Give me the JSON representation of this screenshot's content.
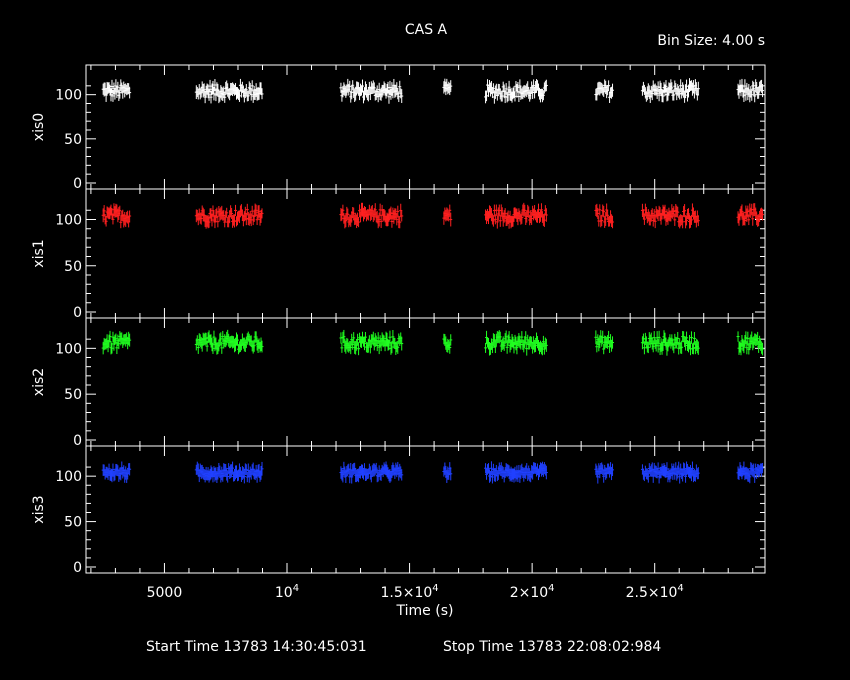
{
  "header": {
    "title": "CAS A",
    "bin_size": "Bin Size: 4.00 s"
  },
  "footer": {
    "start_time": "Start Time 13783 14:30:45:031",
    "stop_time": "Stop Time 13783 22:08:02:984"
  },
  "chart_data": {
    "type": "scatter",
    "title": "CAS A",
    "xlabel": "Time (s)",
    "xlim": [
      1800,
      29500
    ],
    "x_ticks": [
      {
        "value": 5000,
        "label": "5000"
      },
      {
        "value": 10000,
        "label": "10",
        "sup": "4"
      },
      {
        "value": 15000,
        "label": "1.5×10",
        "sup": "4"
      },
      {
        "value": 20000,
        "label": "2×10",
        "sup": "4"
      },
      {
        "value": 25000,
        "label": "2.5×10",
        "sup": "4"
      }
    ],
    "y_ticks": [
      0,
      50,
      100
    ],
    "segments": [
      [
        2500,
        3600
      ],
      [
        6300,
        9000
      ],
      [
        12200,
        14700
      ],
      [
        16400,
        16700
      ],
      [
        18100,
        20600
      ],
      [
        22600,
        23300
      ],
      [
        24500,
        26800
      ],
      [
        28400,
        29800
      ]
    ],
    "panels": [
      {
        "name": "xis0",
        "color": "#ffffff",
        "ylim": [
          0,
          120
        ],
        "mean": 104,
        "spread": 7,
        "top_labels": [
          "100"
        ]
      },
      {
        "name": "xis1",
        "color": "#ff2020",
        "ylim": [
          0,
          120
        ],
        "mean": 104,
        "spread": 7,
        "top_labels": [
          "100"
        ]
      },
      {
        "name": "xis2",
        "color": "#20ff20",
        "ylim": [
          0,
          120
        ],
        "mean": 106,
        "spread": 7,
        "top_labels": [
          "100",
          "0"
        ]
      },
      {
        "name": "xis3",
        "color": "#2040ff",
        "ylim": [
          0,
          120
        ],
        "mean": 104,
        "spread": 5,
        "top_labels": [
          "100",
          "0"
        ]
      }
    ]
  }
}
